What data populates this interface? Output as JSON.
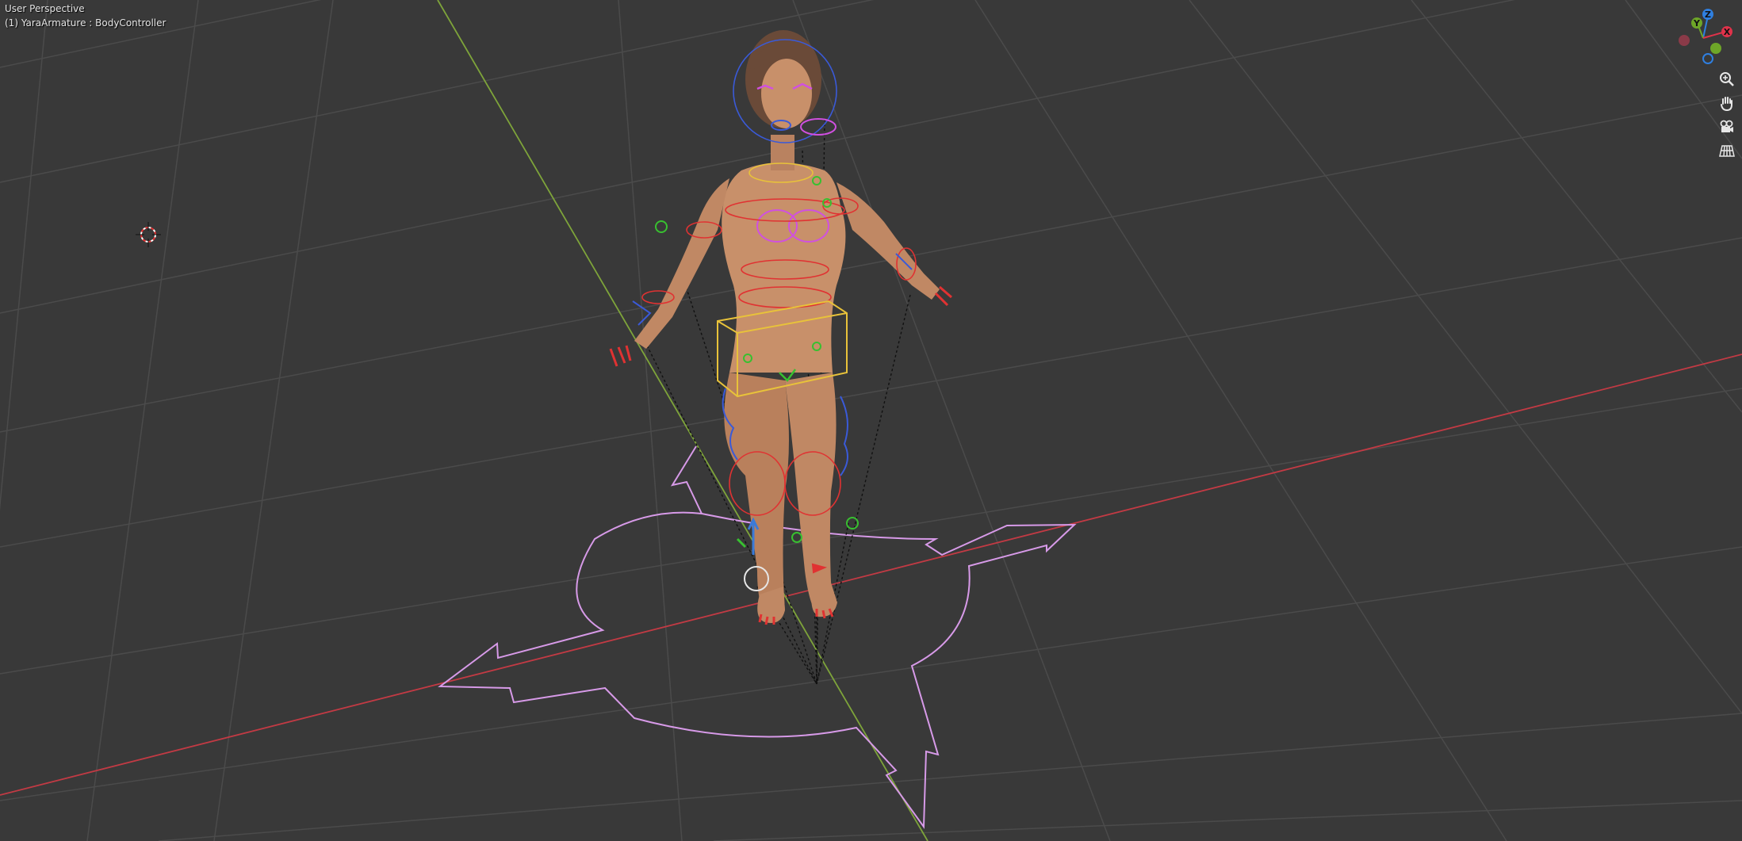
{
  "viewport": {
    "view_name": "User Perspective",
    "active_object": "(1) YaraArmature : BodyController"
  },
  "gizmo": {
    "axes": [
      {
        "label": "Z",
        "color": "#2f7fe0"
      },
      {
        "label": "Y",
        "color": "#6ea628"
      },
      {
        "label": "X",
        "color": "#e0324a"
      }
    ]
  },
  "navigation_tools": [
    {
      "name": "zoom",
      "icon": "magnifier-plus-icon"
    },
    {
      "name": "pan",
      "icon": "hand-icon"
    },
    {
      "name": "camera-view",
      "icon": "camera-icon"
    },
    {
      "name": "toggle-perspective",
      "icon": "grid-icon"
    }
  ],
  "colors": {
    "background": "#393939",
    "grid": "#4b4b4b",
    "x_axis": "#c23a44",
    "y_axis": "#7ea43a",
    "skin": "#c8906a",
    "hair": "#6a4a38",
    "bone_red": "#e03232",
    "bone_blue": "#3a5ad8",
    "bone_yellow": "#e8c23a",
    "bone_magenta": "#d050e0",
    "bone_green": "#38c030",
    "root_control": "#d79ae8"
  }
}
